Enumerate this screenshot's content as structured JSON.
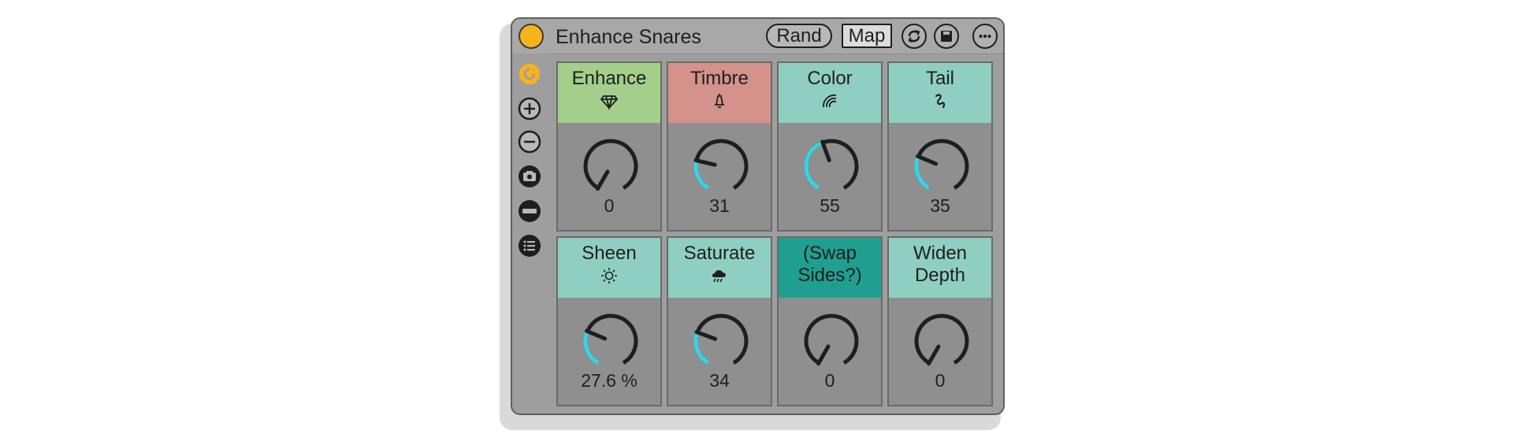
{
  "rack": {
    "title": "Enhance Snares",
    "rand_label": "Rand",
    "map_label": "Map",
    "colors": {
      "power": "#f6b41a",
      "active_arc": "#33d6e8",
      "frame": "#9e9e9e"
    }
  },
  "sidebar": {
    "icons": [
      "macro-variations-icon",
      "add-macro-icon",
      "remove-macro-icon",
      "camera-icon",
      "minus-bar-icon",
      "list-icon"
    ]
  },
  "macros": [
    {
      "label": "Enhance",
      "icon": "diamond-icon",
      "value_text": "0",
      "value": 0,
      "header_color": "#a3cf8a"
    },
    {
      "label": "Timbre",
      "icon": "bell-icon",
      "value_text": "31",
      "value": 31,
      "header_color": "#d4928a"
    },
    {
      "label": "Color",
      "icon": "rainbow-icon",
      "value_text": "55",
      "value": 55,
      "header_color": "#8fcfc2"
    },
    {
      "label": "Tail",
      "icon": "squiggle-icon",
      "value_text": "35",
      "value": 35,
      "header_color": "#8fcfc2"
    },
    {
      "label": "Sheen",
      "icon": "sun-icon",
      "value_text": "27.6 %",
      "value": 27.6,
      "header_color": "#8fcfc2"
    },
    {
      "label": "Saturate",
      "icon": "cloud-rain-icon",
      "value_text": "34",
      "value": 34,
      "header_color": "#8fcfc2"
    },
    {
      "label": "(Swap\nSides?)",
      "icon": "",
      "value_text": "0",
      "value": 0,
      "header_color": "#1f9f90"
    },
    {
      "label": "Widen\nDepth",
      "icon": "",
      "value_text": "0",
      "value": 0,
      "header_color": "#8fcfc2"
    }
  ]
}
